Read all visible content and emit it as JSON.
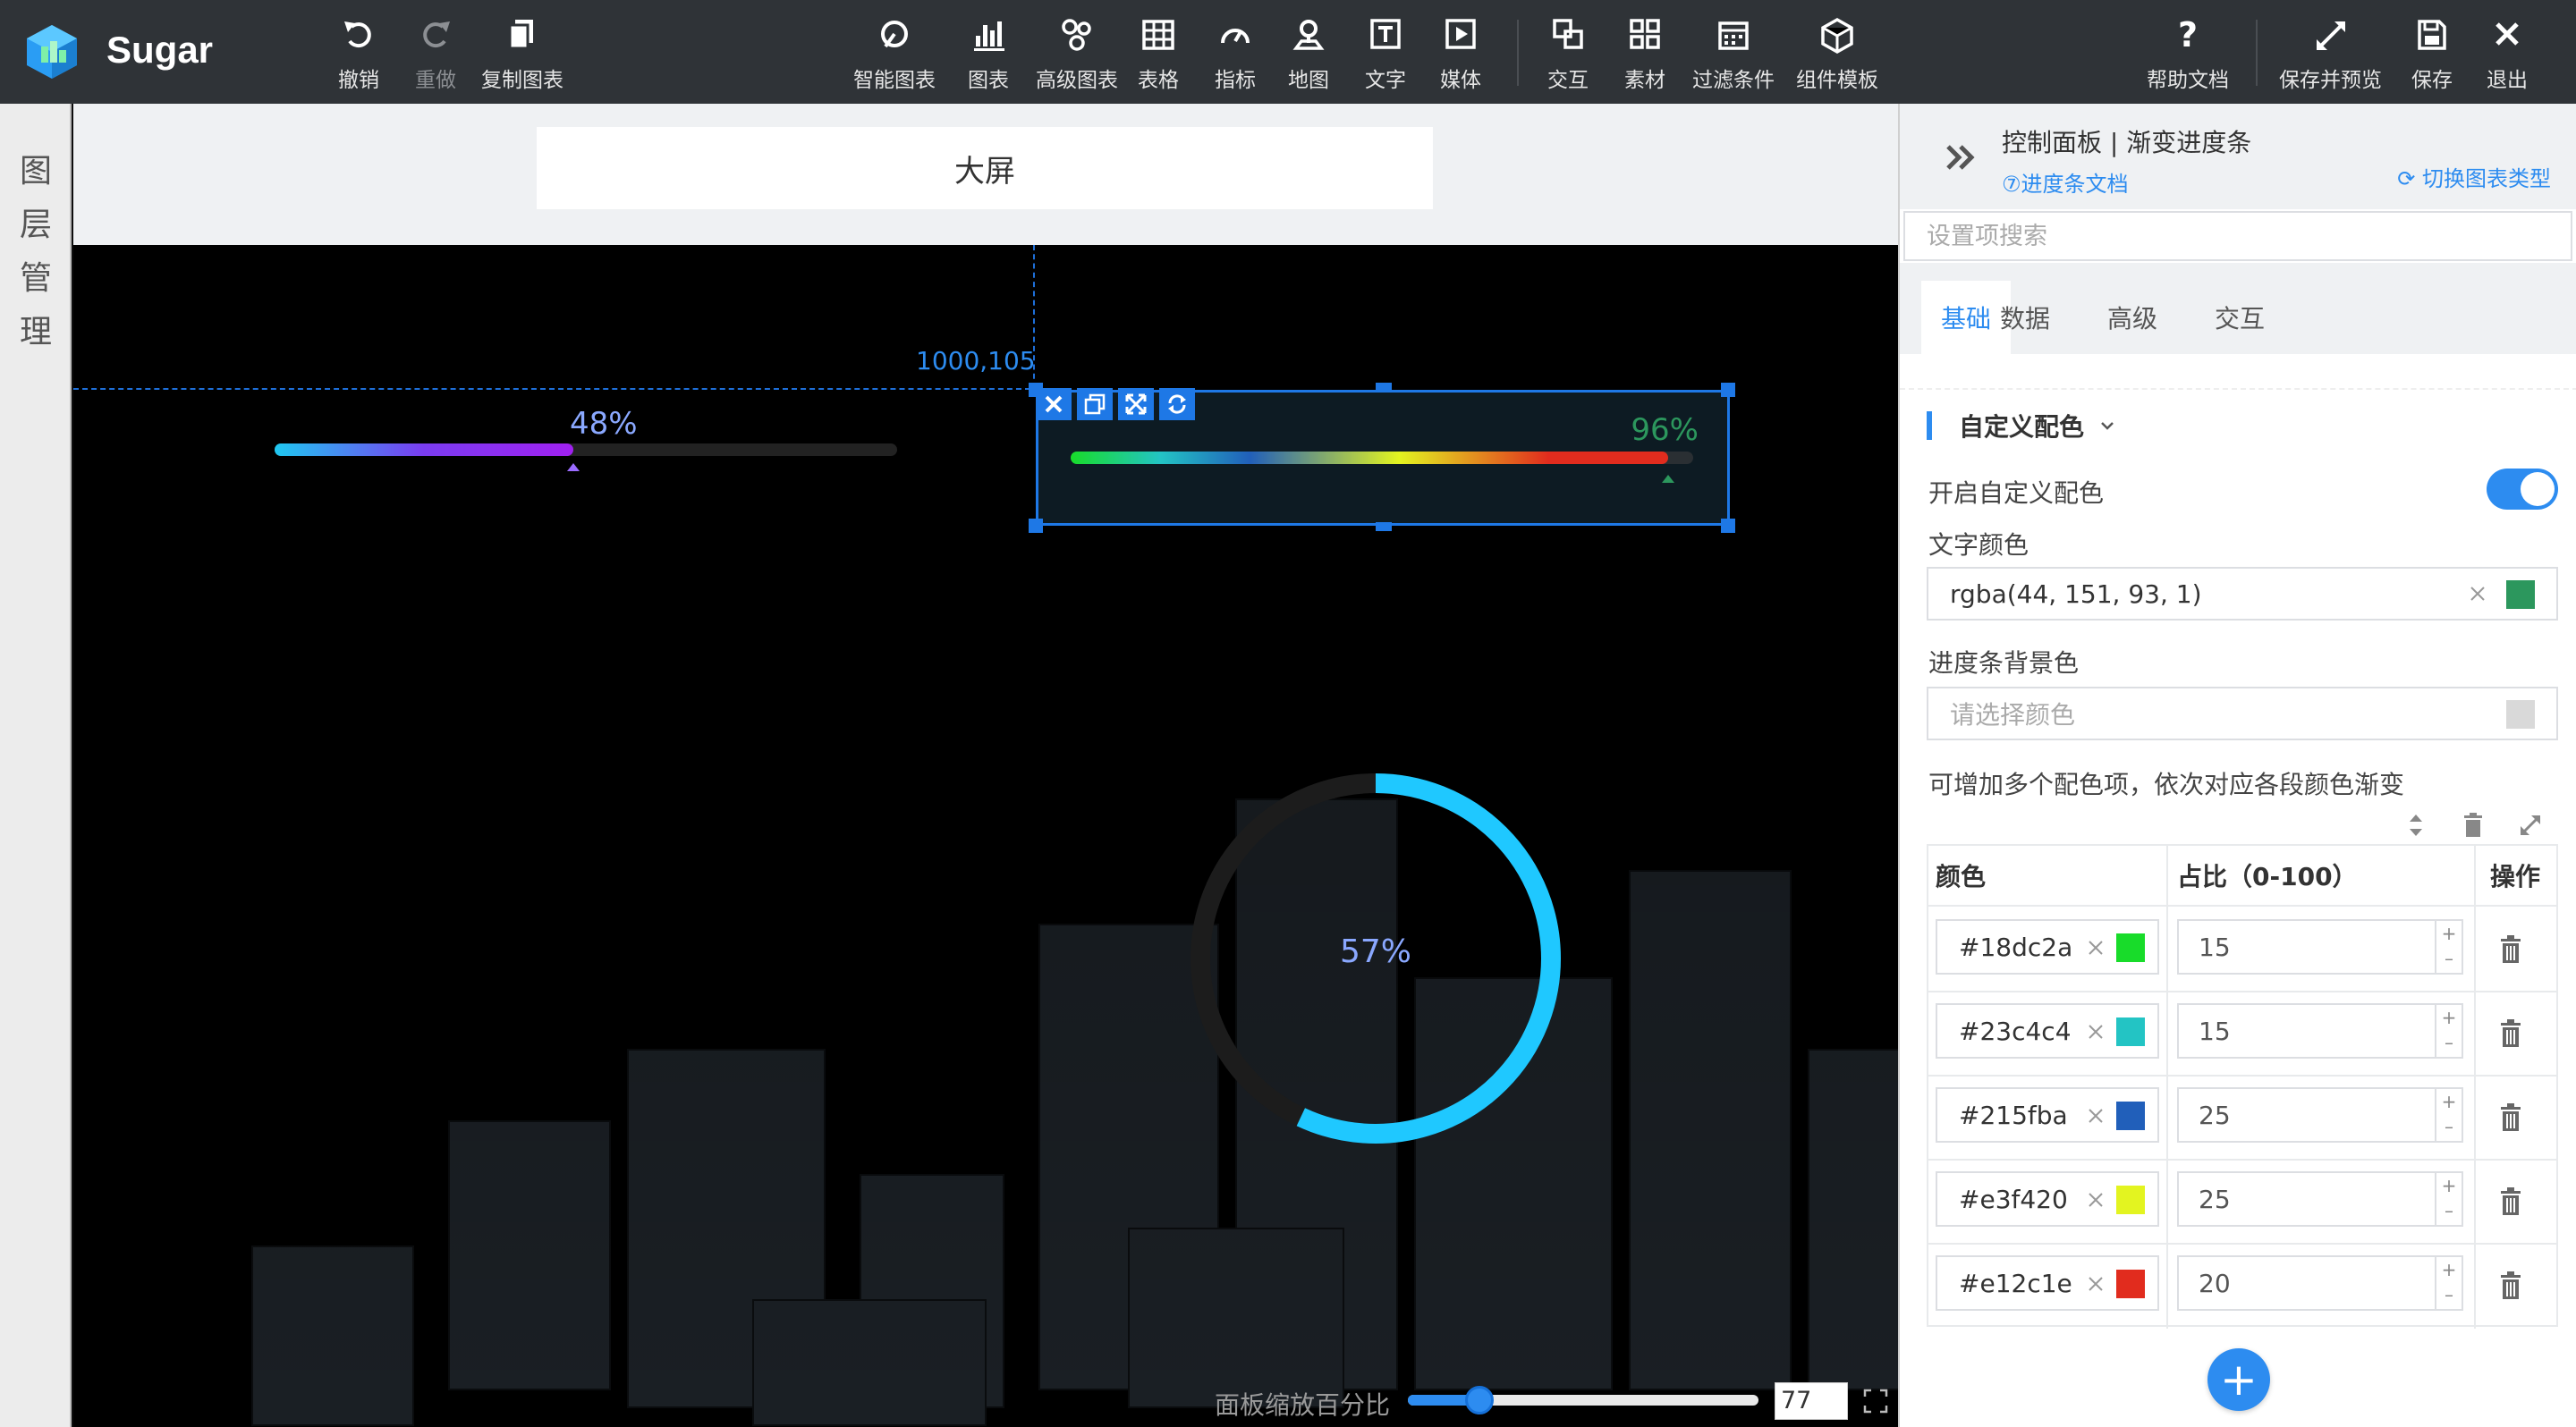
{
  "app": {
    "name": "Sugar"
  },
  "toolbar": {
    "undo": "撤销",
    "redo": "重做",
    "copy_chart": "复制图表",
    "smart_chart": "智能图表",
    "chart": "图表",
    "advanced_chart": "高级图表",
    "table": "表格",
    "indicator": "指标",
    "map": "地图",
    "text": "文字",
    "media": "媒体",
    "interaction": "交互",
    "material": "素材",
    "filter": "过滤条件",
    "template": "组件模板",
    "help": "帮助文档",
    "save_preview": "保存并预览",
    "save": "保存",
    "exit": "退出"
  },
  "layer_panel": {
    "title": "图层管理"
  },
  "canvas": {
    "title": "大屏",
    "coordinate": "1000,105",
    "progress1": {
      "percent_text": "48%",
      "value": 0.48
    },
    "progress2": {
      "percent_text": "96%",
      "value": 0.96
    },
    "ring": {
      "percent_text": "57%",
      "value": 0.57,
      "color": "#1fc8ff",
      "track_color": "#1c1c1c"
    },
    "zoom": {
      "label": "面板缩放百分比",
      "value": "77",
      "fraction": 0.77
    }
  },
  "panel": {
    "title": "控制面板 | 渐变进度条",
    "doc_link": "⑦进度条文档",
    "switch_link": "切换图表类型",
    "search_placeholder": "设置项搜索",
    "tabs": [
      "基础",
      "数据",
      "高级",
      "交互"
    ],
    "active_tab": 0,
    "section_title": "自定义配色",
    "enable_label": "开启自定义配色",
    "enable_on": true,
    "text_color_label": "文字颜色",
    "text_color_value": "rgba(44, 151, 93, 1)",
    "text_color_swatch": "#2c975d",
    "bar_bg_label": "进度条背景色",
    "bar_bg_placeholder": "请选择颜色",
    "hint": "可增加多个配色项，依次对应各段颜色渐变",
    "table_headers": {
      "color": "颜色",
      "ratio": "占比（0-100）",
      "action": "操作"
    },
    "rows": [
      {
        "color": "#18dc2a",
        "ratio": "15"
      },
      {
        "color": "#23c4c4",
        "ratio": "15"
      },
      {
        "color": "#215fba",
        "ratio": "25"
      },
      {
        "color": "#e3f420",
        "ratio": "25"
      },
      {
        "color": "#e12c1e",
        "ratio": "20"
      }
    ]
  },
  "colors": {
    "accent": "#2d8cf0",
    "toolbar_bg": "#2f3337"
  }
}
